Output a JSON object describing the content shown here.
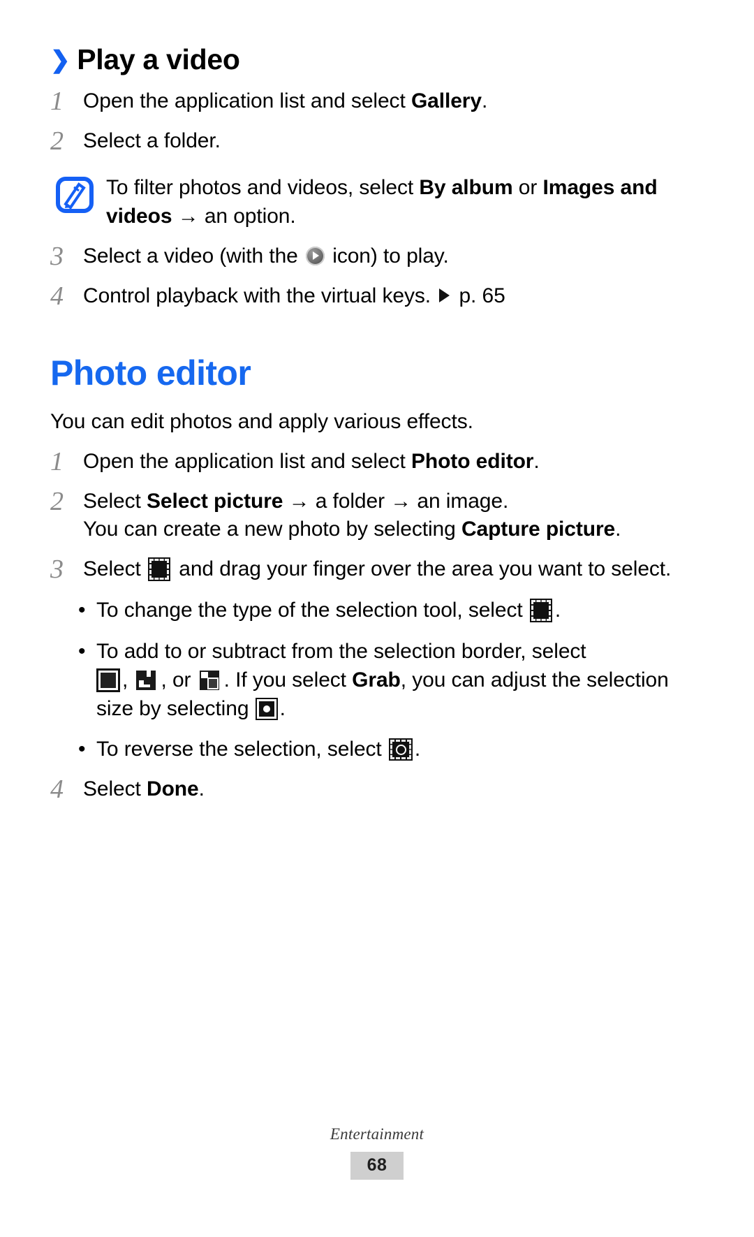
{
  "sections": [
    {
      "chevron": "❯",
      "heading": "Play a video",
      "steps": [
        {
          "num": "1",
          "pre": "Open the application list and select ",
          "bold": "Gallery",
          "post": "."
        },
        {
          "num": "2",
          "pre": "Select a folder.",
          "bold": "",
          "post": ""
        }
      ],
      "note": {
        "icon": "note-pencil-icon",
        "line1_pre": "To filter photos and videos, select ",
        "line1_bold1": "By album",
        "line1_mid": " or ",
        "line1_bold2": "Images and videos",
        "line1_post": " → an option."
      },
      "steps2": [
        {
          "num": "3",
          "pre": "Select a video (with the ",
          "icon": "play-icon",
          "post": " icon) to play."
        },
        {
          "num": "4",
          "pre": "Control playback with the virtual keys. ",
          "icon": "reference-arrow-icon",
          "post": " p. 65"
        }
      ]
    },
    {
      "heading": "Photo editor",
      "intro": "You can edit photos and apply various effects.",
      "steps": [
        {
          "num": "1",
          "pre": "Open the application list and select ",
          "bold": "Photo editor",
          "post": "."
        },
        {
          "num": "2",
          "pre": "Select ",
          "bold": "Select picture",
          "post": " → a folder → an image.",
          "line2_pre": "You can create a new photo by selecting ",
          "line2_bold": "Capture picture",
          "line2_post": "."
        },
        {
          "num": "3",
          "pre": "Select ",
          "icon": "marquee-select-icon",
          "post": " and drag your finger over the area you want to select."
        },
        {
          "num": "4",
          "pre": "Select ",
          "bold": "Done",
          "post": "."
        }
      ],
      "bullets": [
        {
          "dot": "•",
          "pre": "To change the type of the selection tool, select ",
          "icon": "selection-tool-icon",
          "post": "."
        },
        {
          "dot": "•",
          "pre": "To add to or subtract from the selection border, select ",
          "icon1": "square-select-icon",
          "sep1": ", ",
          "icon2": "add-selection-icon",
          "sep2": ", or ",
          "icon3": "subtract-selection-icon",
          "mid": ". If you select ",
          "bold": "Grab",
          "post": ", you can adjust the selection size by selecting ",
          "icon4": "grab-handle-icon",
          "end": "."
        },
        {
          "dot": "•",
          "pre": "To reverse the selection, select ",
          "icon": "inverse-selection-icon",
          "post": "."
        }
      ]
    }
  ],
  "footer": {
    "chapter": "Entertainment",
    "page_number": "68"
  },
  "colors": {
    "accent_blue": "#1668ef",
    "step_number_gray": "#8b8b8b",
    "page_badge_gray": "#cfcfcf"
  }
}
